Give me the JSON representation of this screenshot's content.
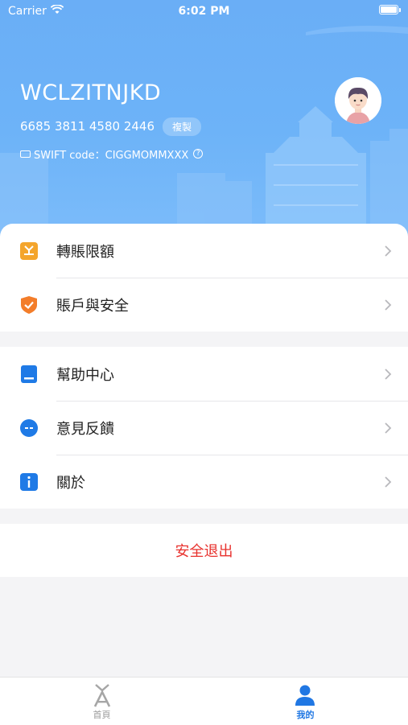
{
  "status_bar": {
    "carrier": "Carrier",
    "time": "6:02 PM"
  },
  "profile": {
    "name": "WCLZITNJKD",
    "account_number": "6685 3811 4580 2446",
    "copy_label": "複製",
    "swift": "SWIFT code：CIGGMOMMXXX",
    "help_glyph": "?"
  },
  "menu_group_1": [
    {
      "label": "轉賬限額",
      "icon": "transfer-limit-icon",
      "color": "#f4a52c"
    },
    {
      "label": "賬戶與安全",
      "icon": "security-shield-icon",
      "color": "#f37d2a"
    }
  ],
  "menu_group_2": [
    {
      "label": "幫助中心",
      "icon": "help-center-icon",
      "color": "#1f7ae6"
    },
    {
      "label": "意見反饋",
      "icon": "feedback-icon",
      "color": "#1f7ae6"
    },
    {
      "label": "關於",
      "icon": "info-icon",
      "color": "#1f7ae6"
    }
  ],
  "logout_label": "安全退出",
  "tabbar": {
    "home_label": "首頁",
    "mine_label": "我的"
  },
  "colors": {
    "accent": "#2077e3",
    "danger": "#e8322e",
    "header": "#6db3f8"
  }
}
